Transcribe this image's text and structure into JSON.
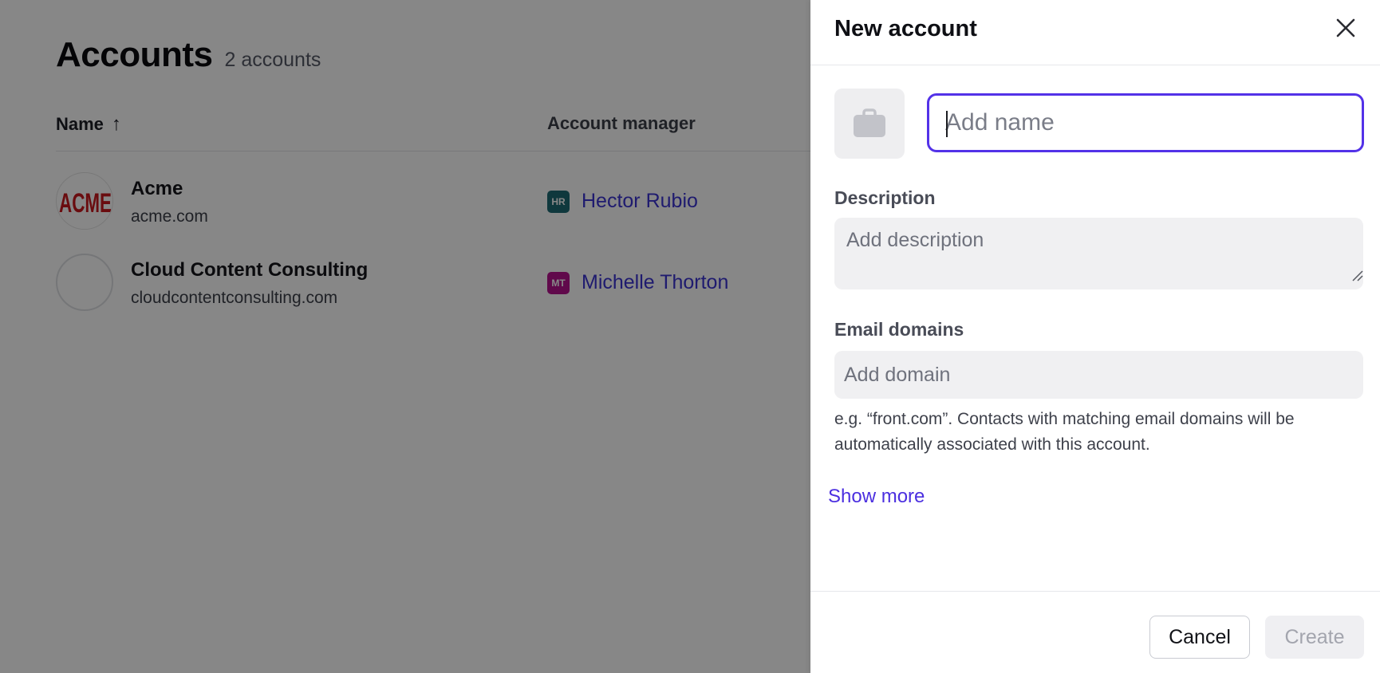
{
  "page": {
    "title": "Accounts",
    "count": "2 accounts",
    "columns": {
      "name": "Name",
      "manager": "Account manager"
    },
    "rows": [
      {
        "name": "Acme",
        "domain": "acme.com",
        "logo": "ACME",
        "manager": {
          "initials": "HR",
          "name": "Hector Rubio",
          "color": "#1e6a74"
        }
      },
      {
        "name": "Cloud Content Consulting",
        "domain": "cloudcontentconsulting.com",
        "logo": "",
        "manager": {
          "initials": "MT",
          "name": "Michelle Thorton",
          "color": "#b5128f"
        }
      }
    ]
  },
  "panel": {
    "title": "New account",
    "name_placeholder": "Add name",
    "description_label": "Description",
    "description_placeholder": "Add description",
    "email_label": "Email domains",
    "domain_placeholder": "Add domain",
    "help_text": "e.g. “front.com”. Contacts with matching email domains will be automatically associated with this account.",
    "show_more": "Show more",
    "cancel_label": "Cancel",
    "create_label": "Create"
  },
  "colors": {
    "accent": "#5332e8",
    "link": "#3b34d2"
  }
}
